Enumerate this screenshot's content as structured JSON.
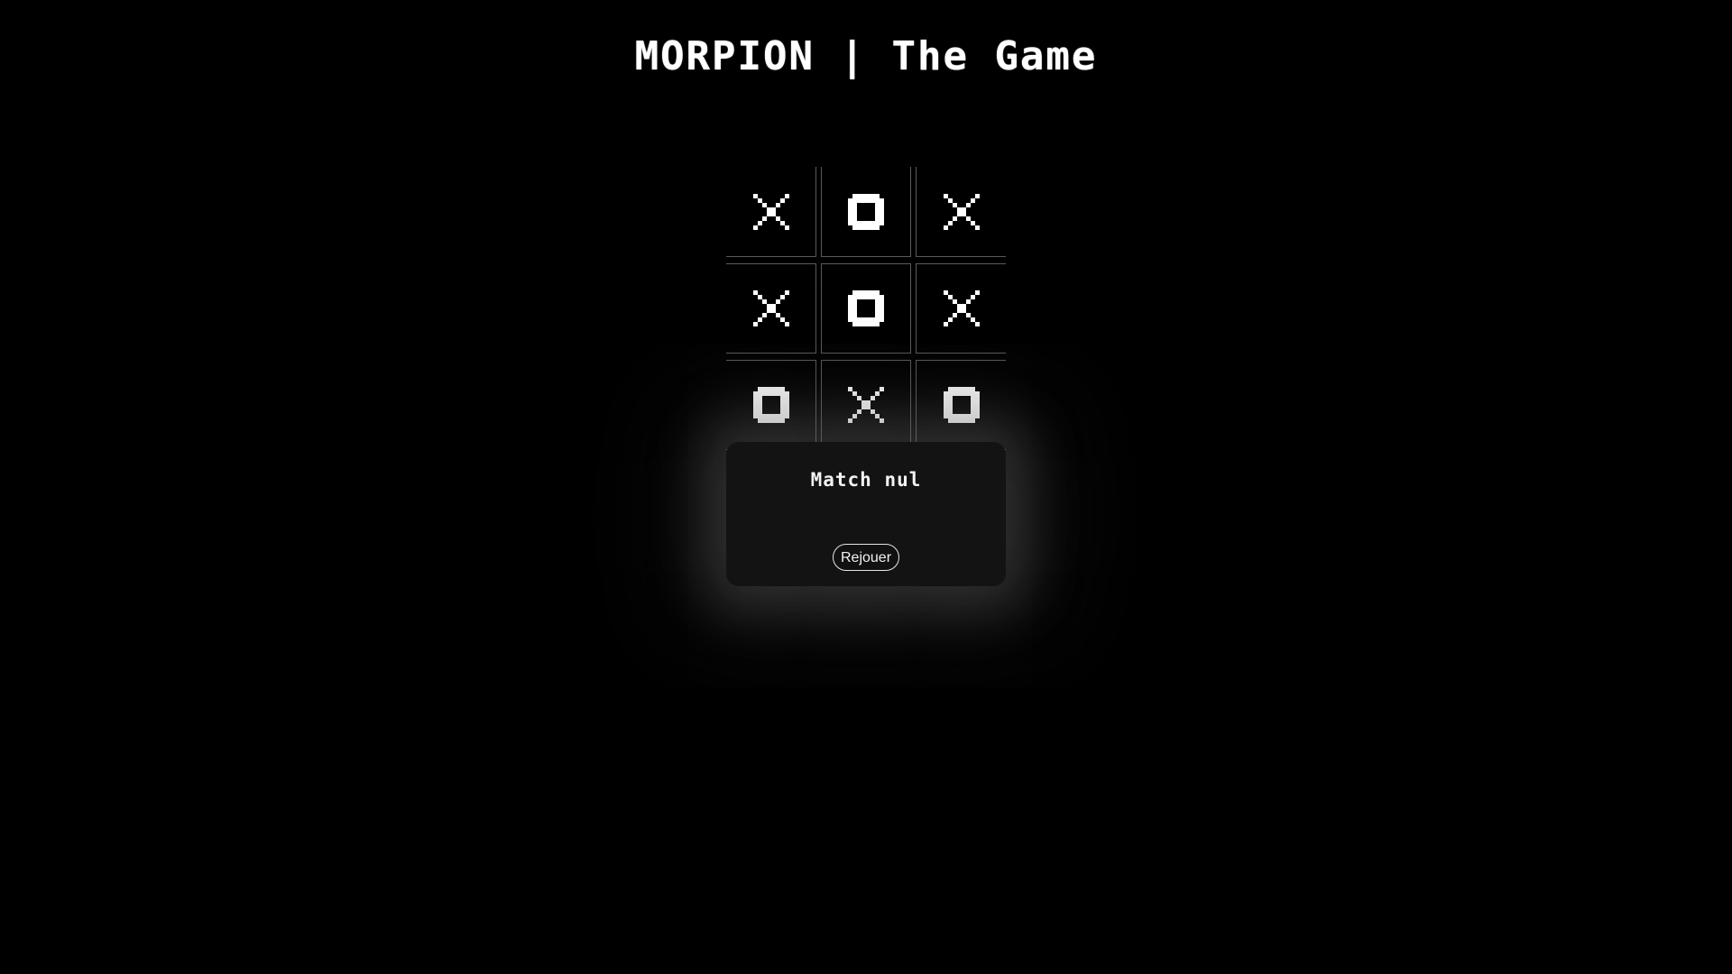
{
  "header": {
    "title": "MORPION | The Game"
  },
  "board": {
    "cells": [
      [
        "X",
        "O",
        "X"
      ],
      [
        "X",
        "O",
        "X"
      ],
      [
        "O",
        "X",
        "O"
      ]
    ]
  },
  "result_modal": {
    "message": "Match nul",
    "replay_label": "Rejouer"
  },
  "colors": {
    "background": "#000000",
    "mark": "#ffffff",
    "grid_line": "#5a5a5a",
    "modal_background": "#131313"
  }
}
